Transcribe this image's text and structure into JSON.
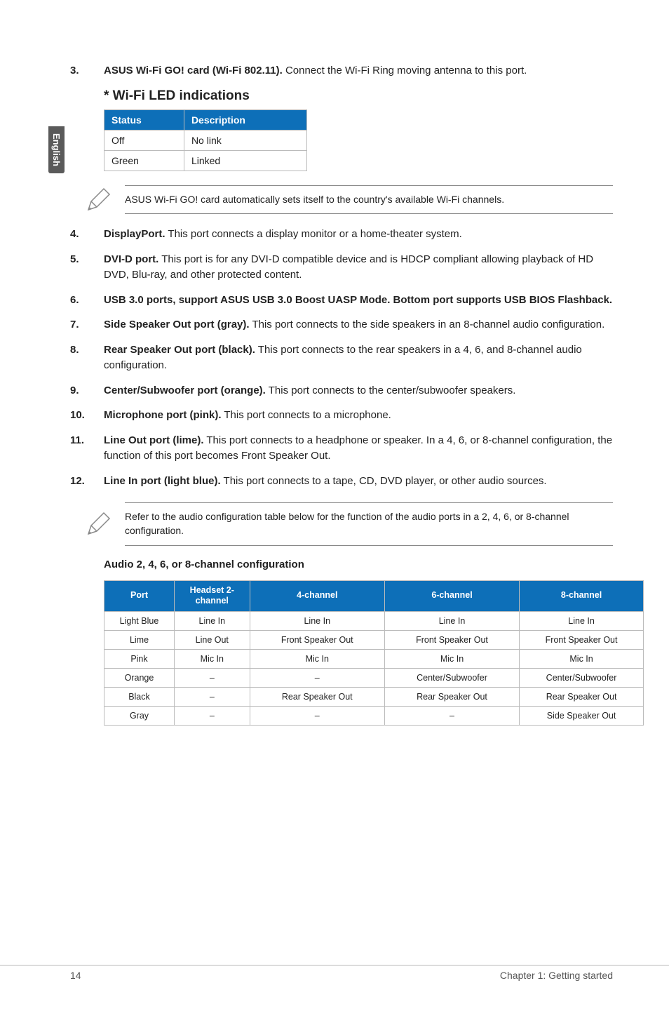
{
  "sideTab": "English",
  "item3": {
    "num": "3.",
    "bold": "ASUS Wi-Fi GO! card (Wi-Fi 802.11).",
    "rest": " Connect the Wi-Fi Ring moving antenna to this port."
  },
  "wifiHeading": "* Wi-Fi LED indications",
  "ledTable": {
    "h1": "Status",
    "h2": "Description",
    "r1c1": "Off",
    "r1c2": "No link",
    "r2c1": "Green",
    "r2c2": "Linked"
  },
  "note1": "ASUS Wi-Fi GO! card automatically sets itself to the country's available Wi-Fi channels.",
  "item4": {
    "num": "4.",
    "bold": "DisplayPort.",
    "rest": " This port connects a display monitor or a home-theater system."
  },
  "item5": {
    "num": "5.",
    "bold": "DVI-D port.",
    "rest": " This port is for any DVI-D compatible device and is HDCP compliant allowing playback of HD DVD, Blu-ray, and other protected content."
  },
  "item6": {
    "num": "6.",
    "text": "USB 3.0 ports, support ASUS USB 3.0 Boost UASP Mode. Bottom port supports USB BIOS Flashback."
  },
  "item7": {
    "num": "7.",
    "bold": "Side Speaker Out port (gray).",
    "rest": " This port connects to the side speakers in an 8-channel audio configuration."
  },
  "item8": {
    "num": "8.",
    "bold": "Rear Speaker Out port (black).",
    "rest": " This port connects to the rear speakers in a 4, 6, and 8-channel audio configuration."
  },
  "item9": {
    "num": "9.",
    "bold": "Center/Subwoofer port (orange).",
    "rest": " This port connects to the center/subwoofer speakers."
  },
  "item10": {
    "num": "10.",
    "bold": "Microphone port (pink).",
    "rest": " This port connects to a microphone."
  },
  "item11": {
    "num": "11.",
    "bold": "Line Out port (lime).",
    "rest": " This port connects to a headphone or speaker. In a 4, 6, or 8-channel configuration, the function of this port becomes Front Speaker Out."
  },
  "item12": {
    "num": "12.",
    "bold": "Line In port (light blue).",
    "rest": " This port connects to a tape, CD, DVD player, or other audio sources."
  },
  "note2": "Refer to the audio configuration table below for the function of the audio ports in a 2, 4, 6, or 8-channel configuration.",
  "audioHeading": "Audio 2, 4, 6, or 8-channel configuration",
  "audioTable": {
    "headers": [
      "Port",
      "Headset 2-channel",
      "4-channel",
      "6-channel",
      "8-channel"
    ],
    "rows": [
      [
        "Light Blue",
        "Line In",
        "Line In",
        "Line In",
        "Line In"
      ],
      [
        "Lime",
        "Line Out",
        "Front Speaker Out",
        "Front Speaker Out",
        "Front Speaker Out"
      ],
      [
        "Pink",
        "Mic In",
        "Mic In",
        "Mic In",
        "Mic In"
      ],
      [
        "Orange",
        "–",
        "–",
        "Center/Subwoofer",
        "Center/Subwoofer"
      ],
      [
        "Black",
        "–",
        "Rear Speaker Out",
        "Rear Speaker Out",
        "Rear Speaker Out"
      ],
      [
        "Gray",
        "–",
        "–",
        "–",
        "Side Speaker Out"
      ]
    ]
  },
  "footer": {
    "left": "14",
    "right": "Chapter 1: Getting started"
  }
}
